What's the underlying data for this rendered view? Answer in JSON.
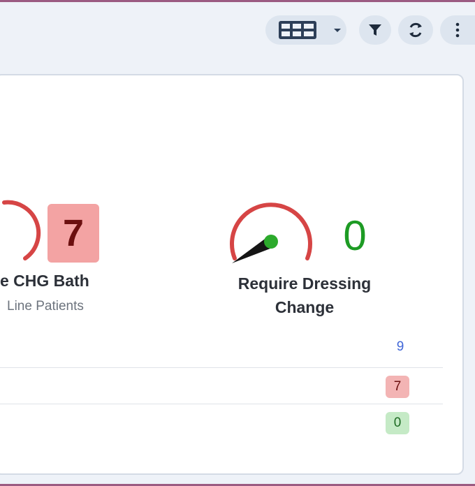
{
  "toolbar": {
    "buttons": [
      {
        "name": "view-layout-button",
        "icon": "grid-layout-icon"
      },
      {
        "name": "filter-button",
        "icon": "filter-icon"
      },
      {
        "name": "refresh-button",
        "icon": "refresh-icon"
      },
      {
        "name": "more-options-button",
        "icon": "vertical-dots-icon"
      }
    ]
  },
  "metrics": [
    {
      "label": "e CHG Bath",
      "sublabel": "Line Patients",
      "value": "7",
      "color": "#f3a3a3"
    },
    {
      "label": "Require Dressing Change",
      "value": "0",
      "color": "#1d9b24",
      "gauge_color": "#d64545"
    }
  ],
  "rows": [
    {
      "count": "9"
    },
    {
      "count": "7",
      "status": "red"
    },
    {
      "count": "0",
      "status": "green"
    }
  ]
}
